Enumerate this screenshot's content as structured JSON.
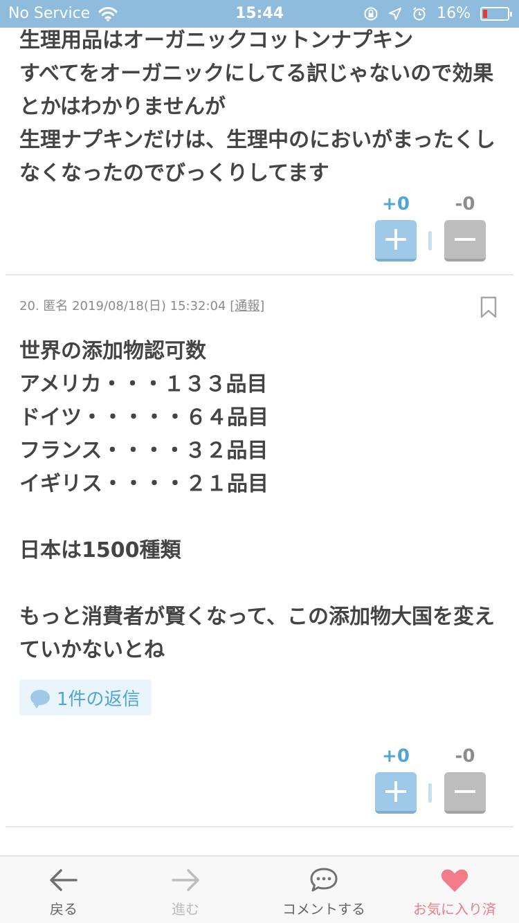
{
  "status_bar": {
    "carrier": "No Service",
    "time": "15:44",
    "battery": "16%",
    "colors": {
      "background": "#8fbcdc",
      "battery_low": "#e53935"
    }
  },
  "previous_comment": {
    "lines": [
      "生理用品はオーガニックコットンナプキン",
      "すべてをオーガニックにしてる訳じゃないので効果",
      "とかはわかりませんが",
      "生理ナプキンだけは、生理中のにおいがまったくし",
      "なくなったのでびっくりしてます"
    ],
    "vote": {
      "plus": "+0",
      "minus": "-0"
    }
  },
  "comment": {
    "number": "20.",
    "author": "匿名",
    "date": "2019/08/18(日) 15:32:04",
    "report_open": "[",
    "report_label": "通報",
    "report_close": "]",
    "lines": [
      "世界の添加物認可数",
      "アメリカ・・・１３３品目",
      "ドイツ・・・・・６４品目",
      "フランス・・・・３２品目",
      "イギリス・・・・２１品目",
      "",
      "日本は1500種類",
      "",
      "もっと消費者が賢くなって、この添加物大国を変え",
      "ていかないとね"
    ],
    "reply_label": "1件の返信",
    "vote": {
      "plus": "+0",
      "minus": "-0"
    }
  },
  "bottom_nav": {
    "back": "戻る",
    "forward": "進む",
    "comment": "コメントする",
    "favorite": "お気に入り済"
  },
  "colors": {
    "accent_blue": "#4fa4d8",
    "favorite_pink": "#f07c8a"
  }
}
